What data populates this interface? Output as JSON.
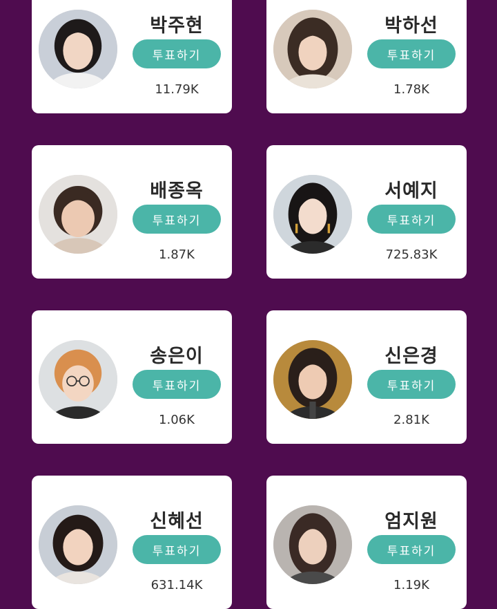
{
  "vote_button_label": "투표하기",
  "colors": {
    "page_background": "#4f0c4f",
    "card_background": "#ffffff",
    "vote_button": "#4bb5a8"
  },
  "candidates": [
    {
      "name": "박주현",
      "votes": "11.79K",
      "photo": "portrait-photo"
    },
    {
      "name": "박하선",
      "votes": "1.78K",
      "photo": "portrait-photo"
    },
    {
      "name": "배종옥",
      "votes": "1.87K",
      "photo": "portrait-photo"
    },
    {
      "name": "서예지",
      "votes": "725.83K",
      "photo": "portrait-photo"
    },
    {
      "name": "송은이",
      "votes": "1.06K",
      "photo": "portrait-photo"
    },
    {
      "name": "신은경",
      "votes": "2.81K",
      "photo": "portrait-photo"
    },
    {
      "name": "신혜선",
      "votes": "631.14K",
      "photo": "portrait-photo"
    },
    {
      "name": "엄지원",
      "votes": "1.19K",
      "photo": "portrait-photo"
    }
  ]
}
